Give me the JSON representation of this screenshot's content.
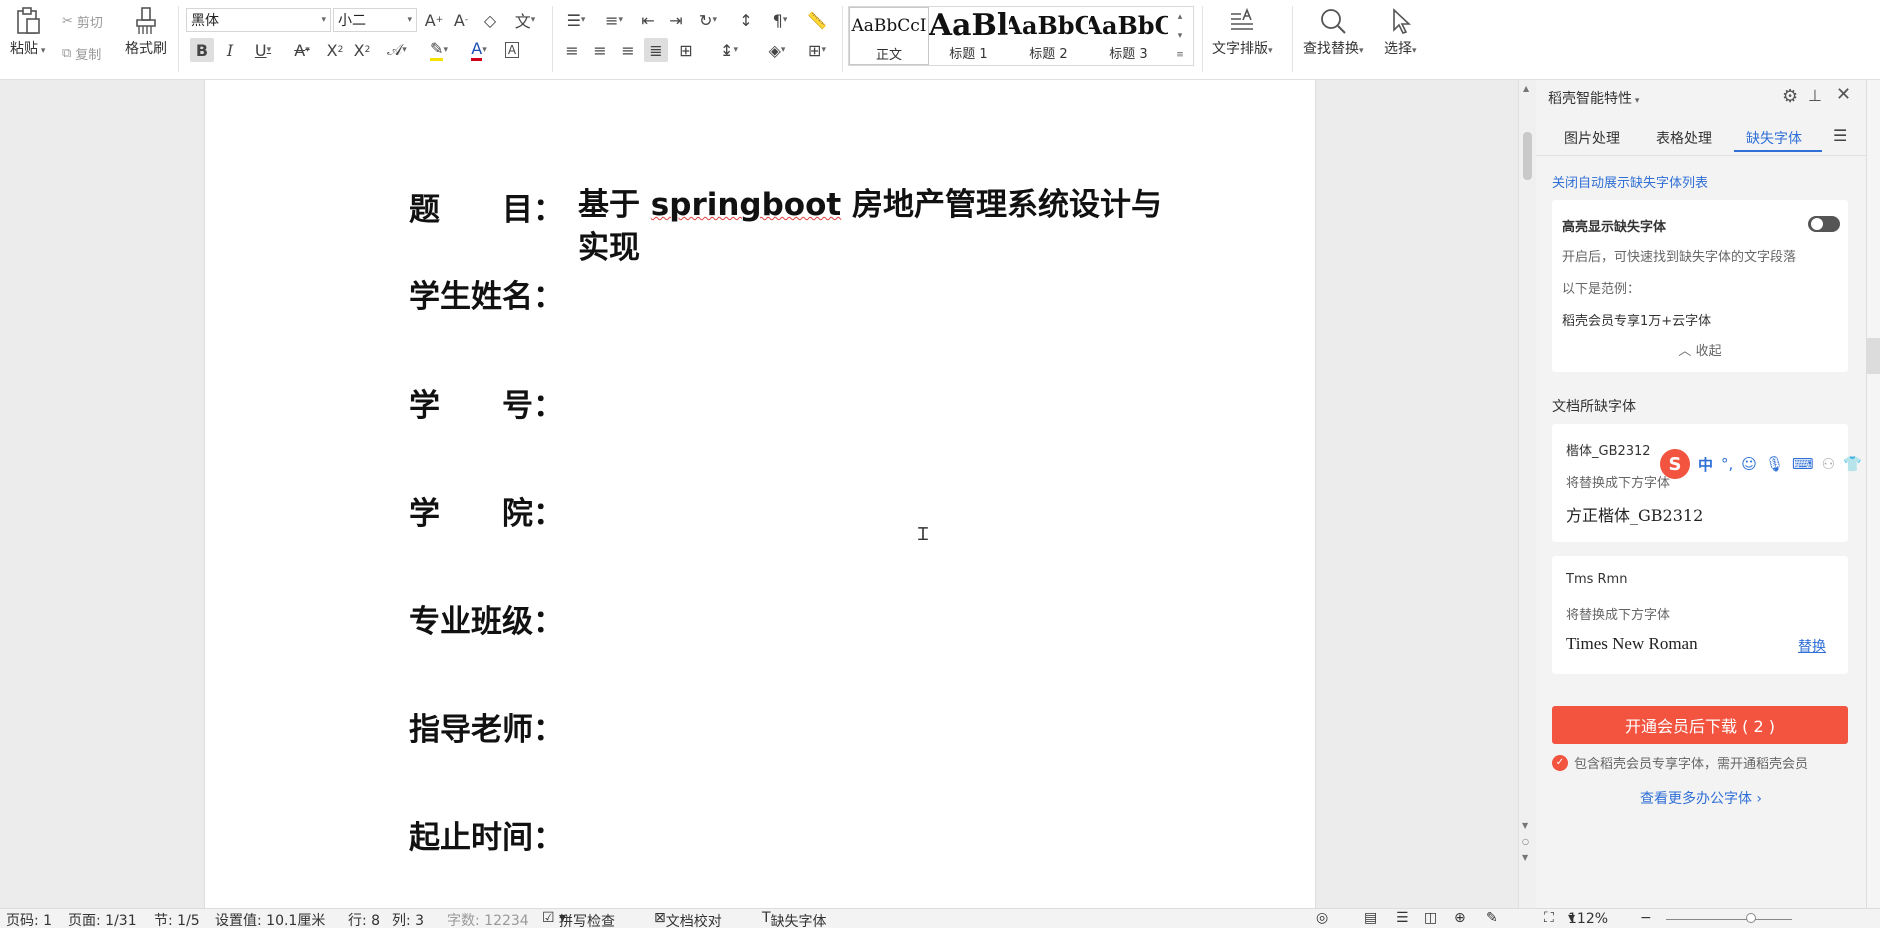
{
  "ribbon": {
    "paste": "粘贴",
    "cut": "剪切",
    "copy": "复制",
    "format_painter": "格式刷",
    "font_name": "黑体",
    "font_size": "小二",
    "style_gallery": [
      {
        "preview": "AaBbCcI",
        "name": "正文"
      },
      {
        "preview": "AaBl",
        "name": "标题 1"
      },
      {
        "preview": "AaBbC",
        "name": "标题 2"
      },
      {
        "preview": "AaBbC",
        "name": "标题 3"
      }
    ],
    "text_layout": "文字排版",
    "find_replace": "查找替换",
    "select": "选择"
  },
  "document": {
    "fields": [
      {
        "label": "题　　目：",
        "value_parts": [
          "基于 ",
          "springboot",
          " 房地产管理系统设计与",
          "实现"
        ]
      },
      {
        "label": "学生姓名："
      },
      {
        "label": "学　　号："
      },
      {
        "label": "学　　院："
      },
      {
        "label": "专业班级："
      },
      {
        "label": "指导老师："
      },
      {
        "label": "起止时间："
      }
    ]
  },
  "panel": {
    "title": "稻壳智能特性",
    "tabs": [
      "图片处理",
      "表格处理",
      "缺失字体"
    ],
    "active_tab": "缺失字体",
    "close_auto_link": "关闭自动展示缺失字体列表",
    "highlight_card": {
      "title": "高亮显示缺失字体",
      "desc": "开启后，可快速找到缺失字体的文字段落",
      "example_label": "以下是范例：",
      "example_text": "稻壳会员专享1万+云字体",
      "collapse": "收起"
    },
    "missing_heading": "文档所缺字体",
    "missing_fonts": [
      {
        "name": "楷体_GB2312",
        "replace_label": "将替换成下方字体",
        "replacement": "方正楷体_GB2312"
      },
      {
        "name": "Tms Rmn",
        "replace_label": "将替换成下方字体",
        "replacement": "Times New Roman",
        "action": "替换"
      }
    ],
    "download_button": "开通会员后下载 ( 2 )",
    "member_note": "包含稻壳会员专享字体，需开通稻壳会员",
    "more_link": "查看更多办公字体",
    "ime_label": "中"
  },
  "status": {
    "page_no": "页码: 1",
    "pages": "页面: 1/31",
    "section": "节: 1/5",
    "setting": "设置值: 10.1厘米",
    "row": "行: 8",
    "col": "列: 3",
    "words": "字数: 12234",
    "spell": "拼写检查",
    "proof": "文档校对",
    "missing_font": "缺失字体",
    "zoom": "112%"
  },
  "colors": {
    "accent": "#2f6fd6",
    "download_btn": "#f25440",
    "toggle_off": "#555555"
  }
}
